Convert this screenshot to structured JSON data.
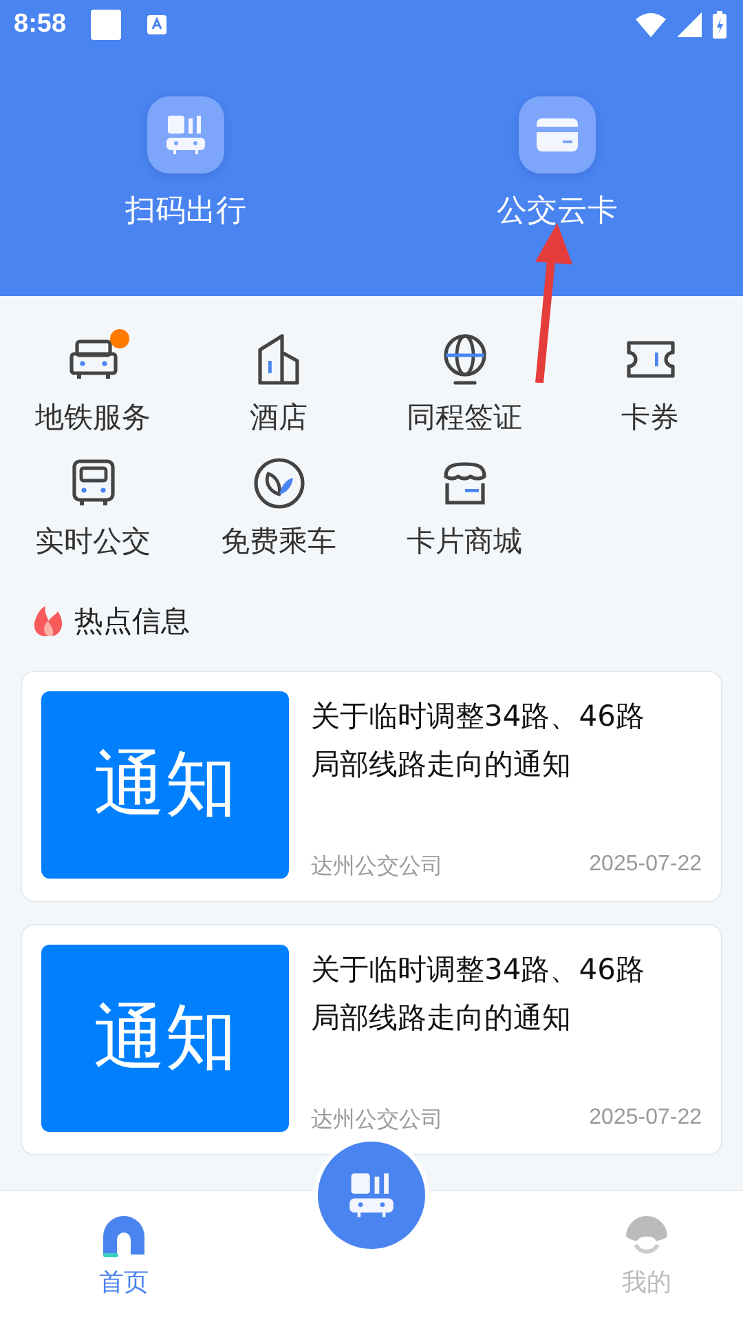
{
  "status_bar": {
    "time": "8:58"
  },
  "header_actions": [
    {
      "label": "扫码出行",
      "kind": "scan"
    },
    {
      "label": "公交云卡",
      "kind": "card"
    }
  ],
  "services": [
    {
      "label": "地铁服务",
      "kind": "metro",
      "badge": true
    },
    {
      "label": "酒店",
      "kind": "hotel",
      "badge": false
    },
    {
      "label": "同程签证",
      "kind": "visa",
      "badge": false
    },
    {
      "label": "卡券",
      "kind": "coupon",
      "badge": false
    },
    {
      "label": "实时公交",
      "kind": "bus",
      "badge": false
    },
    {
      "label": "免费乘车",
      "kind": "free",
      "badge": false
    },
    {
      "label": "卡片商城",
      "kind": "shop",
      "badge": false
    }
  ],
  "hot_section": {
    "title": "热点信息"
  },
  "news": [
    {
      "thumbnail_text": "通知",
      "title": "关于临时调整34路、46路局部线路走向的通知",
      "source": "达州公交公司",
      "date": "2025-07-22"
    },
    {
      "thumbnail_text": "通知",
      "title": "关于临时调整34路、46路局部线路走向的通知",
      "source": "达州公交公司",
      "date": "2025-07-22"
    }
  ],
  "tab_bar": [
    {
      "label": "首页",
      "kind": "home",
      "selected": true
    },
    {
      "label": "我的",
      "kind": "mine",
      "selected": false
    }
  ]
}
